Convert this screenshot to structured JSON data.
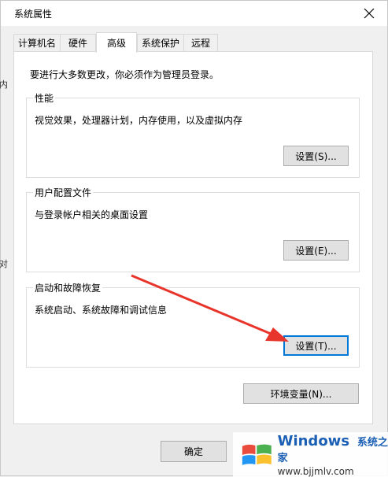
{
  "window": {
    "title": "系统属性"
  },
  "tabs": [
    {
      "label": "计算机名"
    },
    {
      "label": "硬件"
    },
    {
      "label": "高级"
    },
    {
      "label": "系统保护"
    },
    {
      "label": "远程"
    }
  ],
  "left_edge": [
    "内",
    "对"
  ],
  "intro": "要进行大多数更改，你必须作为管理员登录。",
  "groups": {
    "performance": {
      "title": "性能",
      "desc": "视觉效果，处理器计划，内存使用，以及虚拟内存",
      "button": "设置(S)..."
    },
    "profile": {
      "title": "用户配置文件",
      "desc": "与登录帐户相关的桌面设置",
      "button": "设置(E)..."
    },
    "startup": {
      "title": "启动和故障恢复",
      "desc": "系统启动、系统故障和调试信息",
      "button": "设置(T)..."
    }
  },
  "env_button": "环境变量(N)...",
  "footer": {
    "ok": "确定"
  },
  "watermark": {
    "brand": "Windows",
    "cn": "系统之家",
    "url": "www.bjjmlv.com"
  },
  "colors": {
    "focus": "#0078d7",
    "arrow": "#e8352b"
  }
}
